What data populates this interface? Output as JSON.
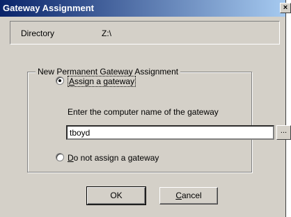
{
  "window": {
    "title": "Gateway Assignment",
    "close_label": "×"
  },
  "directory": {
    "label": "Directory",
    "value": "Z:\\"
  },
  "group": {
    "title": "New Permanent Gateway Assignment",
    "option_assign": {
      "label": "Assign a gateway",
      "checked": true
    },
    "hint": "Enter the computer name of the gateway",
    "gateway_input": {
      "value": "tboyd"
    },
    "browse_label": "...",
    "option_none": {
      "label": "Do not assign a gateway",
      "checked": false
    }
  },
  "buttons": {
    "ok": "OK",
    "cancel": "Cancel"
  }
}
